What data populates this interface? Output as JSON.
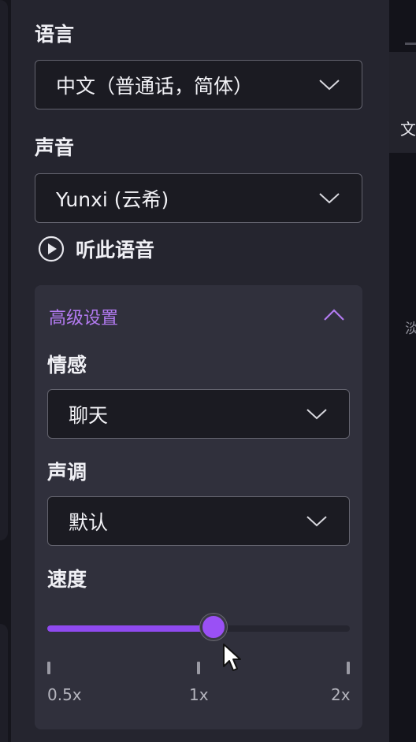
{
  "language": {
    "label": "语言",
    "value": "中文（普通话，简体）"
  },
  "voice": {
    "label": "声音",
    "value": "Yunxi (云希)"
  },
  "preview": {
    "label": "听此语音",
    "icon": "play-circle-icon"
  },
  "advanced": {
    "title": "高级设置",
    "expanded": true,
    "accent_color": "#b27af0",
    "emotion": {
      "label": "情感",
      "value": "聊天"
    },
    "pitch": {
      "label": "声调",
      "value": "默认"
    },
    "speed": {
      "label": "速度",
      "min": 0.5,
      "max": 2,
      "value": 1.1,
      "fill_fraction": 0.55,
      "ticks": [
        "0.5x",
        "1x",
        "2x"
      ],
      "accent_color": "#9a50f5"
    }
  },
  "right_panel": {
    "tab_text": "文",
    "side_text": "淡"
  }
}
